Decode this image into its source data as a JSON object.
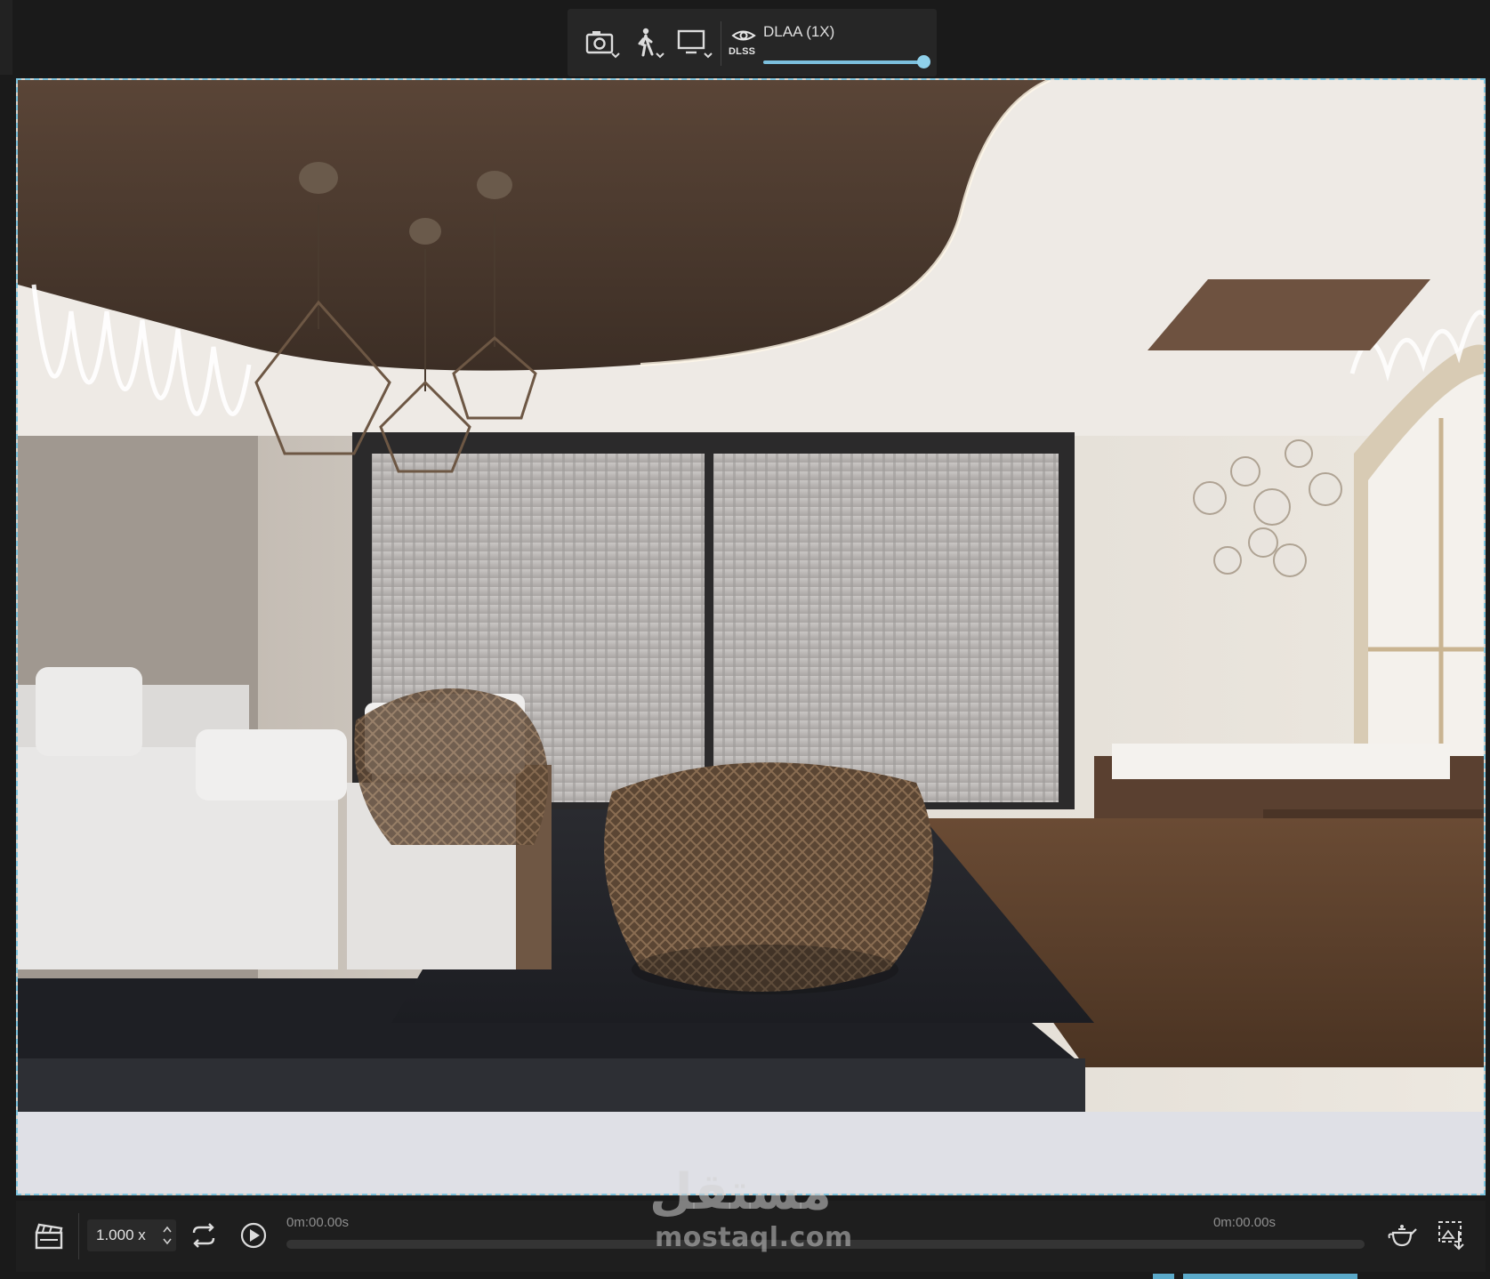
{
  "toolbar": {
    "camera_icon": "camera-icon",
    "walk_icon": "walk-mode-icon",
    "display_icon": "monitor-icon",
    "dlss_logo": "nvidia-eye-icon",
    "dlss_label": "DLSS",
    "dlss_mode": "DLAA (1X)",
    "dlss_slider_value": 1.0
  },
  "viewport": {
    "render_icon": "render-scene"
  },
  "timeline": {
    "clapper_icon": "clapperboard-icon",
    "speed_value": "1.000 x",
    "loop_icon": "loop-icon",
    "play_icon": "play-icon",
    "time_start": "0m:00.00s",
    "time_end": "0m:00.00s",
    "progress": 0,
    "teapot_icon": "teapot-icon",
    "export_icon": "export-icon"
  },
  "watermark": {
    "arabic": "مستقل",
    "latin": "mostaql.com"
  },
  "colors": {
    "accent": "#7cc4de",
    "background": "#1a1a1a",
    "panel": "#262626"
  }
}
